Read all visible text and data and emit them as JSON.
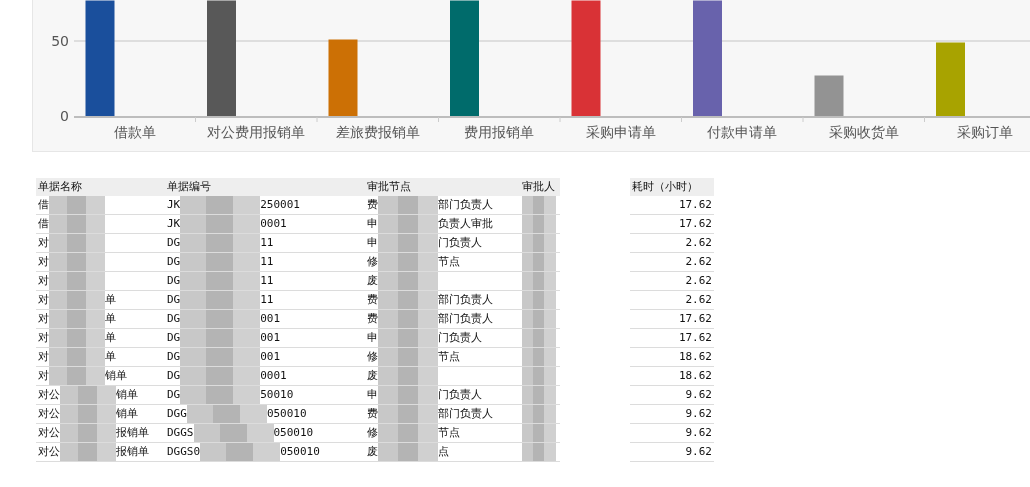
{
  "chart": {
    "chart_data": {
      "type": "bar",
      "categories": [
        "借款单",
        "对公费用报销单",
        "差旅费报销单",
        "费用报销单",
        "采购申请单",
        "付款申请单",
        "采购收货单",
        "采购订单"
      ],
      "series": [
        {
          "color": "#1a4f9c",
          "values": [
            77,
            null,
            null,
            null,
            null,
            null,
            null,
            null
          ]
        },
        {
          "color": "#585858",
          "values": [
            null,
            77,
            null,
            null,
            null,
            null,
            null,
            null
          ]
        },
        {
          "color": "#cc7005",
          "values": [
            null,
            null,
            51,
            null,
            null,
            null,
            null,
            null
          ]
        },
        {
          "color": "#006b6b",
          "values": [
            null,
            null,
            null,
            77,
            null,
            null,
            null,
            null
          ]
        },
        {
          "color": "#d93236",
          "values": [
            null,
            null,
            null,
            null,
            77,
            null,
            null,
            null
          ]
        },
        {
          "color": "#6862ac",
          "values": [
            null,
            null,
            null,
            null,
            null,
            77,
            null,
            null
          ]
        },
        {
          "color": "#939393",
          "values": [
            null,
            null,
            null,
            null,
            null,
            null,
            27,
            null
          ]
        },
        {
          "color": "#a8a300",
          "values": [
            null,
            null,
            null,
            null,
            null,
            null,
            null,
            49
          ]
        }
      ],
      "ylim": [
        0,
        77
      ],
      "yticks": [
        0,
        50
      ]
    }
  },
  "table": {
    "columns": [
      "单据名称",
      "单据编号",
      "审批节点",
      "审批人",
      "耗时（小时）"
    ],
    "rows": [
      {
        "name": {
          "before": "借"
        },
        "code": {
          "before": "JK",
          "after": "250001"
        },
        "node": {
          "before": "费",
          "after": "部门负责人"
        },
        "hours": "17.62"
      },
      {
        "name": {
          "before": "借"
        },
        "code": {
          "before": "JK",
          "after": "0001"
        },
        "node": {
          "before": "申",
          "after": "负责人审批"
        },
        "hours": "17.62"
      },
      {
        "name": {
          "before": "对"
        },
        "code": {
          "before": "DG",
          "after": "11"
        },
        "node": {
          "before": "申",
          "after": "门负责人"
        },
        "hours": "2.62"
      },
      {
        "name": {
          "before": "对"
        },
        "code": {
          "before": "DG",
          "after": "11"
        },
        "node": {
          "before": "修",
          "after": "节点"
        },
        "hours": "2.62"
      },
      {
        "name": {
          "before": "对"
        },
        "code": {
          "before": "DG",
          "after": "11"
        },
        "node": {
          "before": "废"
        },
        "hours": "2.62"
      },
      {
        "name": {
          "before": "对",
          "after": "单"
        },
        "code": {
          "before": "DG",
          "after": "11"
        },
        "node": {
          "before": "费",
          "after": "部门负责人"
        },
        "hours": "2.62"
      },
      {
        "name": {
          "before": "对",
          "after": "单"
        },
        "code": {
          "before": "DG",
          "after": "001"
        },
        "node": {
          "before": "费",
          "after": "部门负责人"
        },
        "hours": "17.62"
      },
      {
        "name": {
          "before": "对",
          "after": "单"
        },
        "code": {
          "before": "DG",
          "after": "001"
        },
        "node": {
          "before": "申",
          "after": "门负责人"
        },
        "hours": "17.62"
      },
      {
        "name": {
          "before": "对",
          "after": "单"
        },
        "code": {
          "before": "DG",
          "after": "001"
        },
        "node": {
          "before": "修",
          "after": "节点"
        },
        "hours": "18.62"
      },
      {
        "name": {
          "before": "对",
          "after": "销单"
        },
        "code": {
          "before": "DG",
          "after": "0001"
        },
        "node": {
          "before": "废"
        },
        "hours": "18.62"
      },
      {
        "name": {
          "before": "对公",
          "after": "销单"
        },
        "code": {
          "before": "DG",
          "after": "50010"
        },
        "node": {
          "before": "申",
          "after": "门负责人"
        },
        "hours": "9.62"
      },
      {
        "name": {
          "before": "对公",
          "after": "销单"
        },
        "code": {
          "before": "DGG",
          "after": "050010"
        },
        "node": {
          "before": "费",
          "after": "部门负责人"
        },
        "hours": "9.62"
      },
      {
        "name": {
          "before": "对公",
          "after": "报销单"
        },
        "code": {
          "before": "DGGS",
          "after": "050010"
        },
        "node": {
          "before": "修",
          "after": "节点"
        },
        "hours": "9.62"
      },
      {
        "name": {
          "before": "对公",
          "after": "报销单"
        },
        "code": {
          "before": "DGGS0",
          "after": "050010"
        },
        "node": {
          "before": "废",
          "after": "点"
        },
        "hours": "9.62"
      }
    ]
  }
}
